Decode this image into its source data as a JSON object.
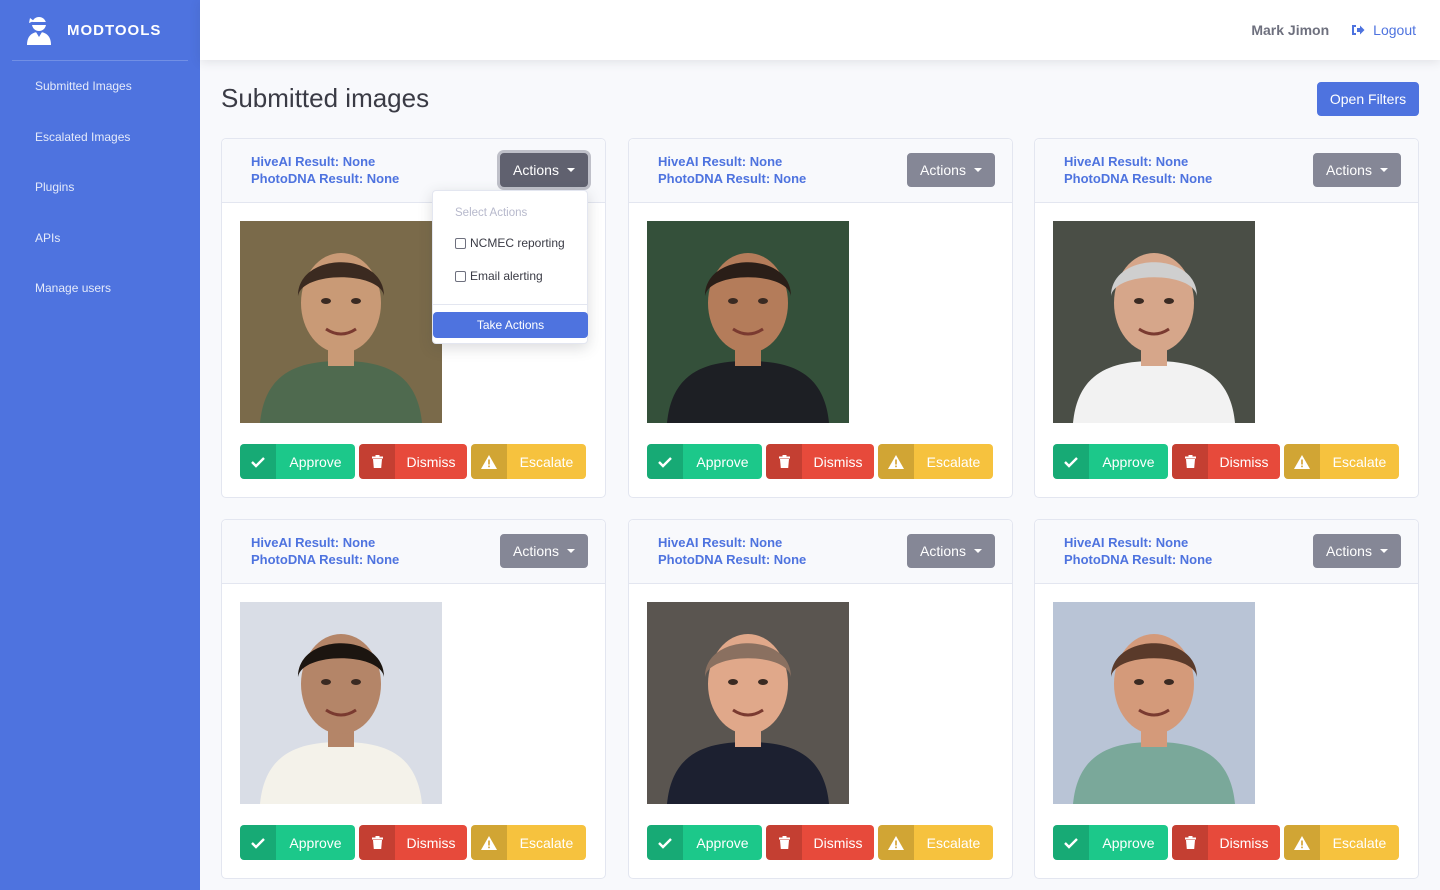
{
  "brand": {
    "name": "MODTOOLS"
  },
  "sidebar": {
    "items": [
      {
        "label": "Submitted Images"
      },
      {
        "label": "Escalated Images"
      },
      {
        "label": "Plugins"
      },
      {
        "label": "APIs"
      },
      {
        "label": "Manage users"
      }
    ]
  },
  "topbar": {
    "user_name": "Mark Jimon",
    "logout_label": "Logout"
  },
  "main": {
    "title": "Submitted images",
    "filters_label": "Open Filters"
  },
  "card_labels": {
    "hive": "HiveAI Result: None",
    "dna": "PhotoDNA Result: None",
    "actions": "Actions",
    "approve": "Approve",
    "dismiss": "Dismiss",
    "escalate": "Escalate"
  },
  "dropdown": {
    "header": "Select Actions",
    "options": [
      "NCMEC reporting",
      "Email alerting"
    ],
    "submit_label": "Take Actions"
  },
  "colors": {
    "primary": "#4e73df",
    "secondary": "#858796",
    "success": "#1cc88a",
    "danger": "#e74a3b",
    "warning": "#f6c23e"
  }
}
